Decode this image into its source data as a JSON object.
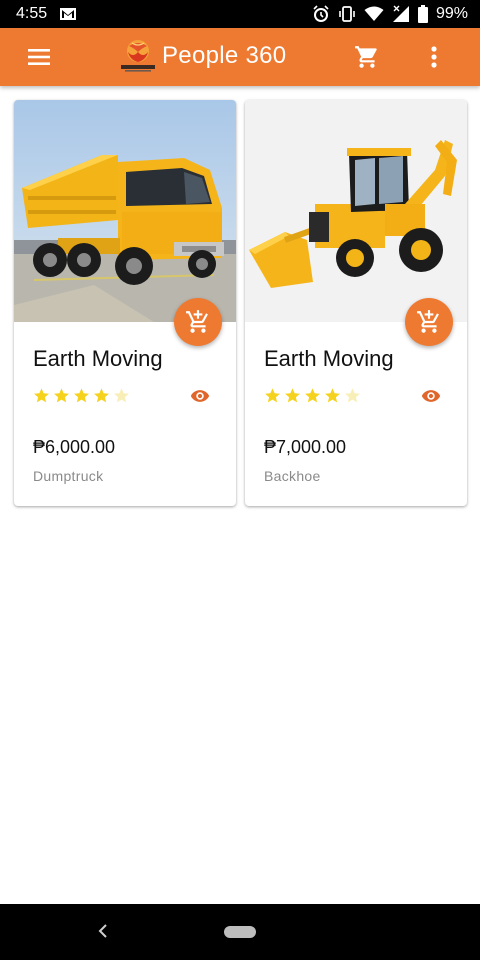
{
  "status_bar": {
    "time": "4:55",
    "battery": "99%"
  },
  "app_bar": {
    "title": "People 360"
  },
  "products": [
    {
      "title": "Earth Moving",
      "rating": 4,
      "max_rating": 5,
      "price": "₱6,000.00",
      "subtitle": "Dumptruck",
      "image": "dump-truck"
    },
    {
      "title": "Earth Moving",
      "rating": 4,
      "max_rating": 5,
      "price": "₱7,000.00",
      "subtitle": "Backhoe",
      "image": "backhoe-loader"
    }
  ],
  "colors": {
    "primary": "#EE7A31",
    "star": "#F5D21E",
    "star_empty": "#F8EFB8",
    "text": "#111111",
    "muted": "#8a8a8a"
  }
}
